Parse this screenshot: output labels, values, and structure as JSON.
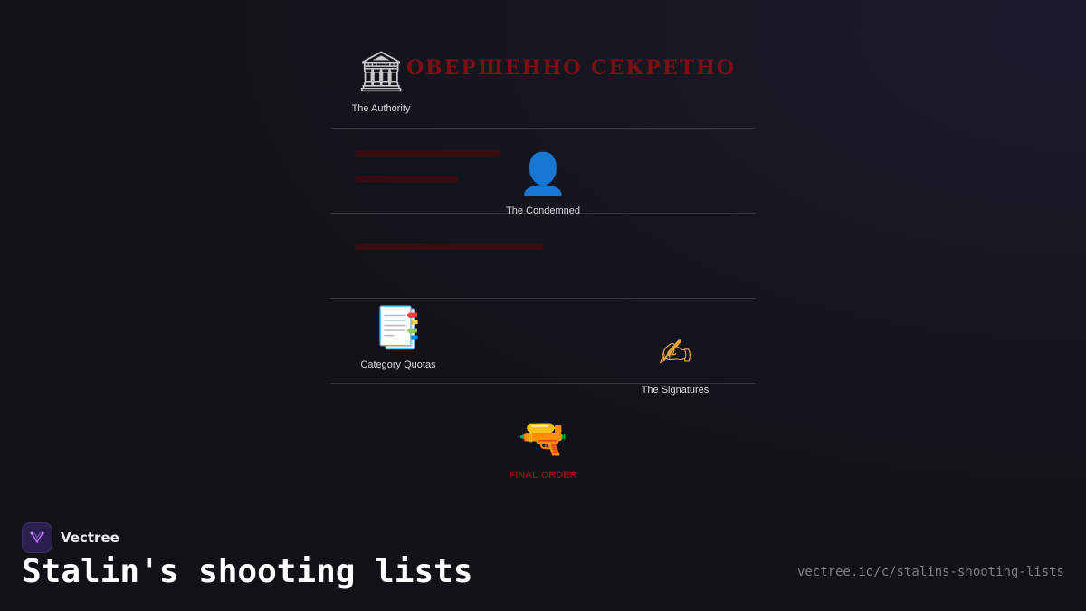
{
  "diagram": {
    "stamp_text": "ОВЕРШЕННО СЕКРЕТНО",
    "nodes": [
      {
        "label": "The Authority",
        "icon": "classical-building-icon",
        "glyph": "🏛"
      },
      {
        "label": "The Condemned",
        "icon": "person-silhouette-icon",
        "glyph": "👤"
      },
      {
        "label": "Category Quotas",
        "icon": "bookmark-tabs-document-icon",
        "glyph": "📑"
      },
      {
        "label": "The Signatures",
        "icon": "writing-hand-icon",
        "glyph": "✍"
      },
      {
        "label": "FINAL ORDER",
        "icon": "pistol-icon",
        "glyph": "🔫"
      }
    ]
  },
  "colors": {
    "background": "#111116",
    "stamp_red": "#7a0f14",
    "redaction": "#3a0b10",
    "final_label": "#8a1116"
  },
  "footer": {
    "brand_name": "Vectree",
    "brand_icon": "vectree-logo-icon",
    "title": "Stalin's shooting lists",
    "url": "vectree.io/c/stalins-shooting-lists"
  }
}
